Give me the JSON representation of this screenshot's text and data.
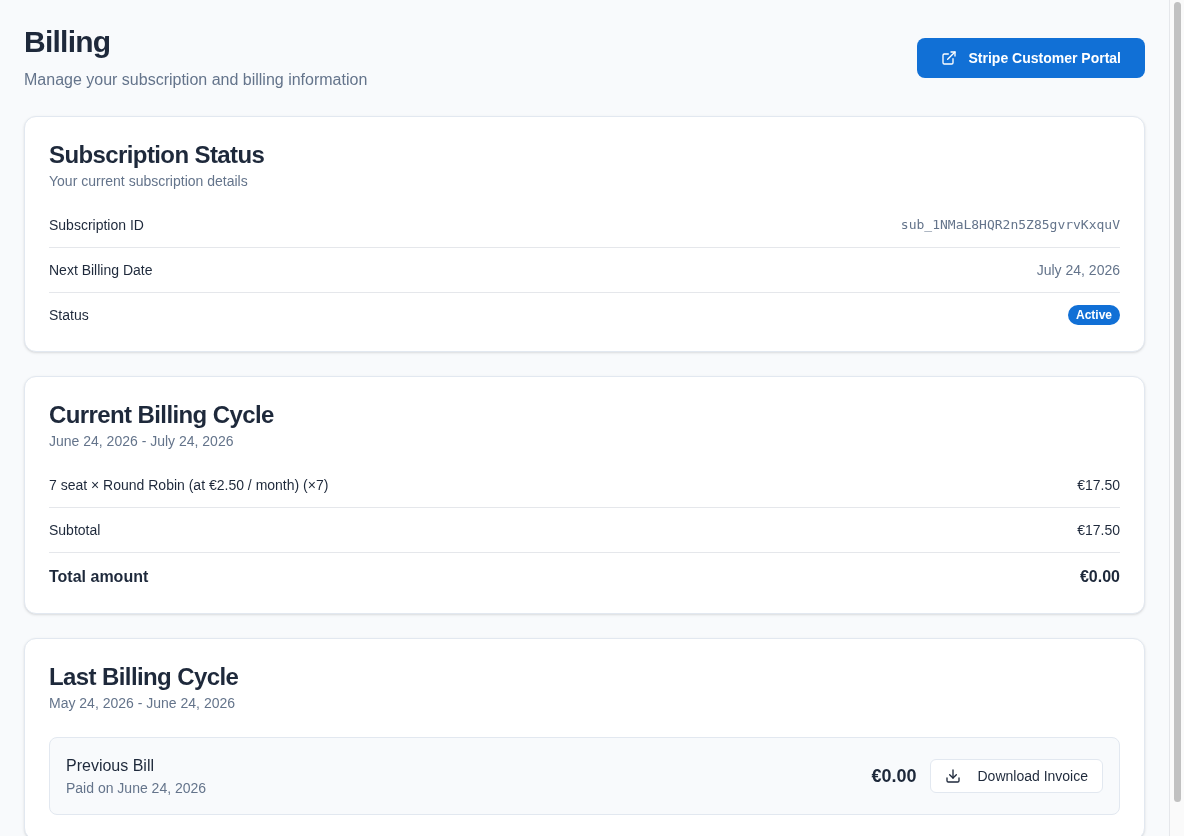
{
  "header": {
    "title": "Billing",
    "subtitle": "Manage your subscription and billing information",
    "portal_button": {
      "label": "Stripe Customer Portal"
    }
  },
  "subscription_status": {
    "title": "Subscription Status",
    "subtitle": "Your current subscription details",
    "rows": [
      {
        "kind": "mono",
        "label": "Subscription ID",
        "value": "sub_1NMaL8HQR2n5Z85gvrvKxquV"
      },
      {
        "kind": "text",
        "label": "Next Billing Date",
        "value": "July 24, 2026"
      },
      {
        "kind": "badge",
        "label": "Status",
        "value": "Active"
      }
    ]
  },
  "current_billing_cycle": {
    "title": "Current Billing Cycle",
    "period": "June 24, 2026 - July 24, 2026",
    "lines": [
      {
        "kind": "item",
        "label": "7 seat × Round Robin (at €2.50 / month) (×7)",
        "amount": "€17.50"
      },
      {
        "kind": "item",
        "label": "Subtotal",
        "amount": "€17.50"
      },
      {
        "kind": "total",
        "label": "Total amount",
        "amount": "€0.00"
      }
    ]
  },
  "last_billing_cycle": {
    "title": "Last Billing Cycle",
    "period": "May 24, 2026 - June 24, 2026",
    "bill": {
      "title": "Previous Bill",
      "paid_on": "Paid on June 24, 2026",
      "amount": "€0.00",
      "download_button": {
        "label": "Download Invoice"
      }
    }
  }
}
